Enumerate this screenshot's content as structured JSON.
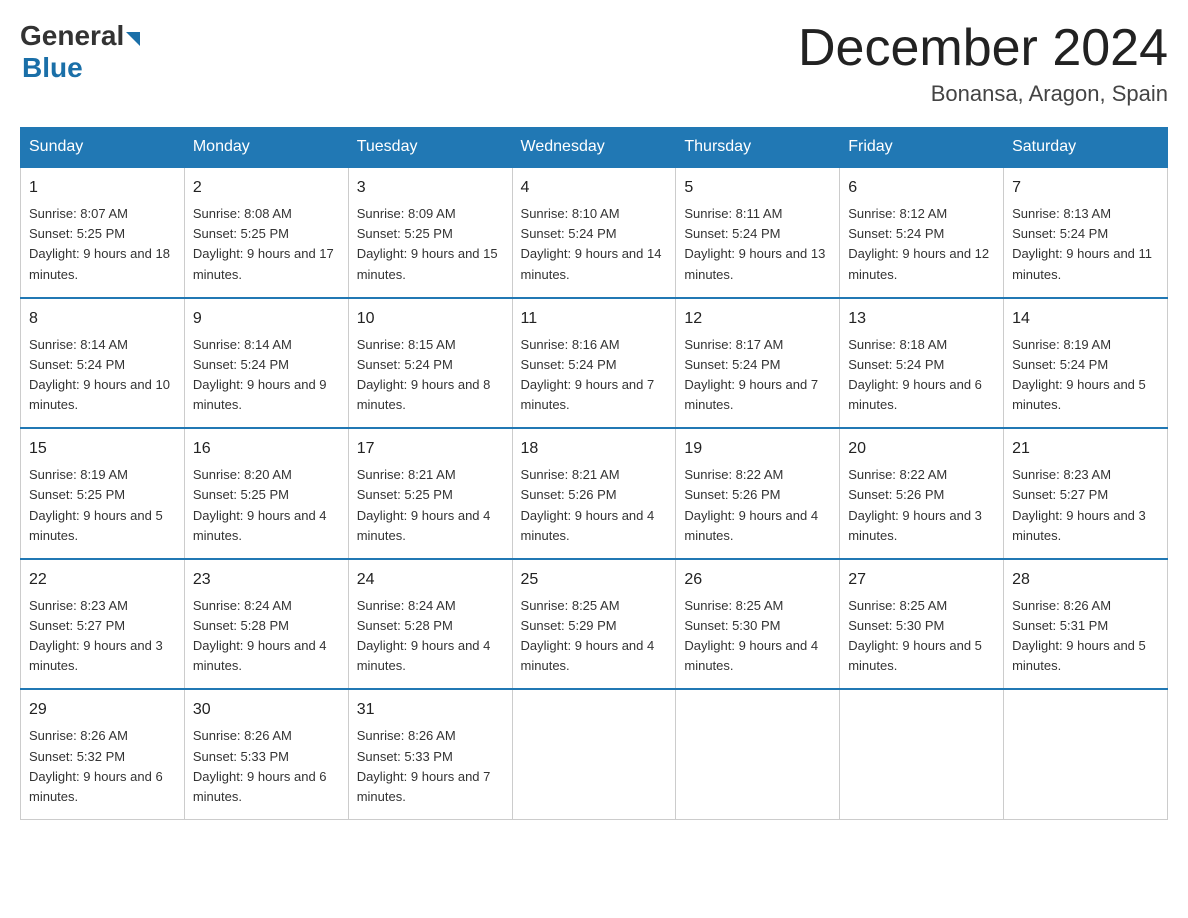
{
  "header": {
    "logo": {
      "general": "General",
      "blue": "Blue"
    },
    "title": "December 2024",
    "location": "Bonansa, Aragon, Spain"
  },
  "weekdays": [
    "Sunday",
    "Monday",
    "Tuesday",
    "Wednesday",
    "Thursday",
    "Friday",
    "Saturday"
  ],
  "weeks": [
    [
      {
        "day": "1",
        "sunrise": "8:07 AM",
        "sunset": "5:25 PM",
        "daylight": "9 hours and 18 minutes."
      },
      {
        "day": "2",
        "sunrise": "8:08 AM",
        "sunset": "5:25 PM",
        "daylight": "9 hours and 17 minutes."
      },
      {
        "day": "3",
        "sunrise": "8:09 AM",
        "sunset": "5:25 PM",
        "daylight": "9 hours and 15 minutes."
      },
      {
        "day": "4",
        "sunrise": "8:10 AM",
        "sunset": "5:24 PM",
        "daylight": "9 hours and 14 minutes."
      },
      {
        "day": "5",
        "sunrise": "8:11 AM",
        "sunset": "5:24 PM",
        "daylight": "9 hours and 13 minutes."
      },
      {
        "day": "6",
        "sunrise": "8:12 AM",
        "sunset": "5:24 PM",
        "daylight": "9 hours and 12 minutes."
      },
      {
        "day": "7",
        "sunrise": "8:13 AM",
        "sunset": "5:24 PM",
        "daylight": "9 hours and 11 minutes."
      }
    ],
    [
      {
        "day": "8",
        "sunrise": "8:14 AM",
        "sunset": "5:24 PM",
        "daylight": "9 hours and 10 minutes."
      },
      {
        "day": "9",
        "sunrise": "8:14 AM",
        "sunset": "5:24 PM",
        "daylight": "9 hours and 9 minutes."
      },
      {
        "day": "10",
        "sunrise": "8:15 AM",
        "sunset": "5:24 PM",
        "daylight": "9 hours and 8 minutes."
      },
      {
        "day": "11",
        "sunrise": "8:16 AM",
        "sunset": "5:24 PM",
        "daylight": "9 hours and 7 minutes."
      },
      {
        "day": "12",
        "sunrise": "8:17 AM",
        "sunset": "5:24 PM",
        "daylight": "9 hours and 7 minutes."
      },
      {
        "day": "13",
        "sunrise": "8:18 AM",
        "sunset": "5:24 PM",
        "daylight": "9 hours and 6 minutes."
      },
      {
        "day": "14",
        "sunrise": "8:19 AM",
        "sunset": "5:24 PM",
        "daylight": "9 hours and 5 minutes."
      }
    ],
    [
      {
        "day": "15",
        "sunrise": "8:19 AM",
        "sunset": "5:25 PM",
        "daylight": "9 hours and 5 minutes."
      },
      {
        "day": "16",
        "sunrise": "8:20 AM",
        "sunset": "5:25 PM",
        "daylight": "9 hours and 4 minutes."
      },
      {
        "day": "17",
        "sunrise": "8:21 AM",
        "sunset": "5:25 PM",
        "daylight": "9 hours and 4 minutes."
      },
      {
        "day": "18",
        "sunrise": "8:21 AM",
        "sunset": "5:26 PM",
        "daylight": "9 hours and 4 minutes."
      },
      {
        "day": "19",
        "sunrise": "8:22 AM",
        "sunset": "5:26 PM",
        "daylight": "9 hours and 4 minutes."
      },
      {
        "day": "20",
        "sunrise": "8:22 AM",
        "sunset": "5:26 PM",
        "daylight": "9 hours and 3 minutes."
      },
      {
        "day": "21",
        "sunrise": "8:23 AM",
        "sunset": "5:27 PM",
        "daylight": "9 hours and 3 minutes."
      }
    ],
    [
      {
        "day": "22",
        "sunrise": "8:23 AM",
        "sunset": "5:27 PM",
        "daylight": "9 hours and 3 minutes."
      },
      {
        "day": "23",
        "sunrise": "8:24 AM",
        "sunset": "5:28 PM",
        "daylight": "9 hours and 4 minutes."
      },
      {
        "day": "24",
        "sunrise": "8:24 AM",
        "sunset": "5:28 PM",
        "daylight": "9 hours and 4 minutes."
      },
      {
        "day": "25",
        "sunrise": "8:25 AM",
        "sunset": "5:29 PM",
        "daylight": "9 hours and 4 minutes."
      },
      {
        "day": "26",
        "sunrise": "8:25 AM",
        "sunset": "5:30 PM",
        "daylight": "9 hours and 4 minutes."
      },
      {
        "day": "27",
        "sunrise": "8:25 AM",
        "sunset": "5:30 PM",
        "daylight": "9 hours and 5 minutes."
      },
      {
        "day": "28",
        "sunrise": "8:26 AM",
        "sunset": "5:31 PM",
        "daylight": "9 hours and 5 minutes."
      }
    ],
    [
      {
        "day": "29",
        "sunrise": "8:26 AM",
        "sunset": "5:32 PM",
        "daylight": "9 hours and 6 minutes."
      },
      {
        "day": "30",
        "sunrise": "8:26 AM",
        "sunset": "5:33 PM",
        "daylight": "9 hours and 6 minutes."
      },
      {
        "day": "31",
        "sunrise": "8:26 AM",
        "sunset": "5:33 PM",
        "daylight": "9 hours and 7 minutes."
      },
      null,
      null,
      null,
      null
    ]
  ]
}
